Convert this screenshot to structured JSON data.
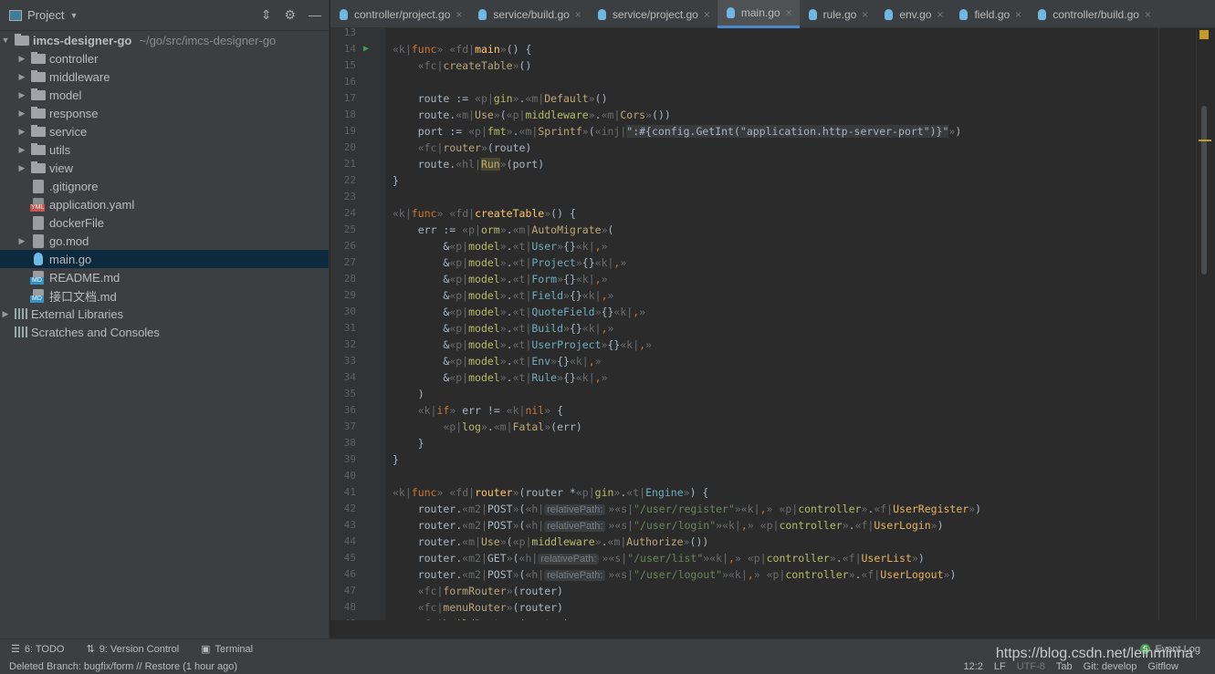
{
  "sidebar": {
    "title": "Project",
    "root": {
      "name": "imcs-designer-go",
      "path": "~/go/src/imcs-designer-go"
    },
    "items": [
      {
        "label": "controller",
        "type": "folder"
      },
      {
        "label": "middleware",
        "type": "folder"
      },
      {
        "label": "model",
        "type": "folder"
      },
      {
        "label": "response",
        "type": "folder"
      },
      {
        "label": "service",
        "type": "folder"
      },
      {
        "label": "utils",
        "type": "folder"
      },
      {
        "label": "view",
        "type": "folder"
      },
      {
        "label": ".gitignore",
        "type": "file"
      },
      {
        "label": "application.yaml",
        "type": "yml"
      },
      {
        "label": "dockerFile",
        "type": "file"
      },
      {
        "label": "go.mod",
        "type": "file",
        "expandable": true
      },
      {
        "label": "main.go",
        "type": "go",
        "selected": true
      },
      {
        "label": "README.md",
        "type": "md"
      },
      {
        "label": "接口文档.md",
        "type": "md"
      }
    ],
    "extra": [
      {
        "label": "External Libraries",
        "icon": "libraries-icon"
      },
      {
        "label": "Scratches and Consoles",
        "icon": "scratches-icon"
      }
    ]
  },
  "tabs": [
    {
      "label": "controller/project.go"
    },
    {
      "label": "service/build.go"
    },
    {
      "label": "service/project.go"
    },
    {
      "label": "main.go",
      "active": true
    },
    {
      "label": "rule.go"
    },
    {
      "label": "env.go"
    },
    {
      "label": "field.go"
    },
    {
      "label": "controller/build.go"
    }
  ],
  "editor": {
    "first_line": 13,
    "lines": [
      "",
      "«k|func» «fd|main»() {",
      "    «fc|createTable»()",
      "",
      "    route := «p|gin».«m|Default»()",
      "    route.«m|Use»(«p|middleware».«m|Cors»())",
      "    port := «p|fmt».«m|Sprintf»(«inj|\":#{config.GetInt(\"application.http-server-port\")}\"»)",
      "    «fc|router»(route)",
      "    route.«hl|Run»(port)",
      "}",
      "",
      "«k|func» «fd|createTable»() {",
      "    err := «p|orm».«m|AutoMigrate»(",
      "        &«p|model».«t|User»{}«k|,»",
      "        &«p|model».«t|Project»{}«k|,»",
      "        &«p|model».«t|Form»{}«k|,»",
      "        &«p|model».«t|Field»{}«k|,»",
      "        &«p|model».«t|QuoteField»{}«k|,»",
      "        &«p|model».«t|Build»{}«k|,»",
      "        &«p|model».«t|UserProject»{}«k|,»",
      "        &«p|model».«t|Env»{}«k|,»",
      "        &«p|model».«t|Rule»{}«k|,»",
      "    )",
      "    «k|if» err != «k|nil» {",
      "        «p|log».«m|Fatal»(err)",
      "    }",
      "}",
      "",
      "«k|func» «fd|router»(router *«p|gin».«t|Engine») {",
      "    router.«m2|POST»(«h|relativePath:»«s|\"/user/register\"»«k|,» «p|controller».«f|UserRegister»)",
      "    router.«m2|POST»(«h|relativePath:»«s|\"/user/login\"»«k|,» «p|controller».«f|UserLogin»)",
      "    router.«m|Use»(«p|middleware».«m|Authorize»())",
      "    router.«m2|GET»(«h|relativePath:»«s|\"/user/list\"»«k|,» «p|controller».«f|UserList»)",
      "    router.«m2|POST»(«h|relativePath:»«s|\"/user/logout\"»«k|,» «p|controller».«f|UserLogout»)",
      "    «fc|formRouter»(router)",
      "    «fc|menuRouter»(router)",
      "    «fc|buildRouter»(router)"
    ]
  },
  "toolbar": {
    "todo": "6: TODO",
    "vcs": "9: Version Control",
    "terminal": "Terminal",
    "event_log": "Event Log",
    "event_count": "5"
  },
  "status": {
    "message": "Deleted Branch: bugfix/form // Restore (1 hour ago)",
    "position": "12:2",
    "line_sep": "LF",
    "encoding": "UTF-8",
    "indent": "Tab",
    "git": "Git: develop",
    "gitflow": "Gitflow"
  },
  "watermark": "https://blog.csdn.net/leinminna",
  "colors": {
    "keyword": "#cc7832",
    "function": "#ffc66d",
    "string": "#6a8759",
    "selection": "#0d293e",
    "active_tab": "#4a88c7"
  }
}
